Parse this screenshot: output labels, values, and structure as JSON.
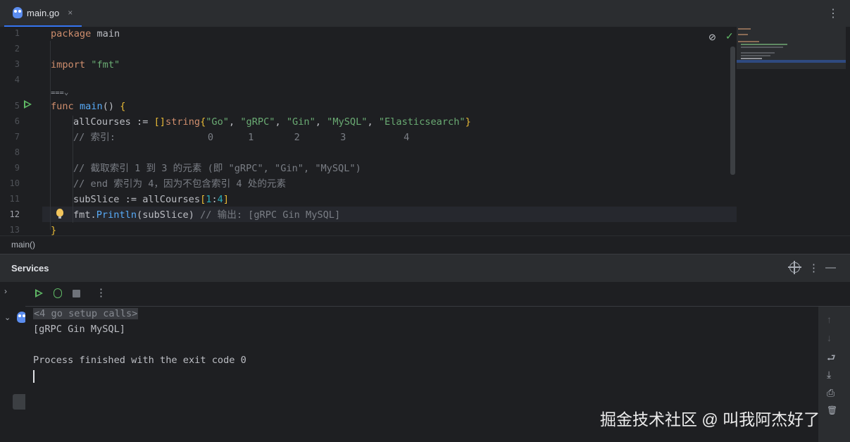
{
  "tab": {
    "file_name": "main.go",
    "close_glyph": "×",
    "menu_glyph": "⋮"
  },
  "editor": {
    "line_numbers": [
      "1",
      "2",
      "3",
      "4",
      "5",
      "6",
      "7",
      "8",
      "9",
      "10",
      "11",
      "12",
      "13"
    ],
    "lines": {
      "l1_kw": "package",
      "l1_rest": " main",
      "l3_kw": "import",
      "l3_str": "\"fmt\"",
      "l5_kw": "func",
      "l5_fn": "main",
      "l5_rest": "() ",
      "l6_a": "allCourses := ",
      "l6_b": "[]",
      "l6_c": "string",
      "l6_d": "{",
      "l6_s1": "\"Go\"",
      "l6_s2": "\"gRPC\"",
      "l6_s3": "\"Gin\"",
      "l6_s4": "\"MySQL\"",
      "l6_s5": "\"Elasticsearch\"",
      "l6_e": "}",
      "l7": "// 索引:                0      1       2       3          4",
      "l9": "// 截取索引 1 到 3 的元素 (即 \"gRPC\", \"Gin\", \"MySQL\")",
      "l10": "// end 索引为 4，因为不包含索引 4 处的元素",
      "l11_a": "subSlice := allCourses",
      "l11_b": "[",
      "l11_n1": "1",
      "l11_c": ":",
      "l11_n2": "4",
      "l11_d": "]",
      "l12_a": "fmt.",
      "l12_fn": "Println",
      "l12_b": "(subSlice) ",
      "l12_com": "// 输出: [gRPC Gin MySQL]",
      "l13": "}"
    },
    "inlay_hint": "⩶⌄",
    "breadcrumb": "main()"
  },
  "services": {
    "title": "Services",
    "more_glyph": "⋮",
    "minimize_glyph": "—",
    "tree_expand_glyph": "›",
    "tree_node_glyph": "⌄",
    "console": {
      "setup_calls": "<4 go setup calls>",
      "output": "[gRPC Gin MySQL]",
      "exit": "Process finished with the exit code 0"
    },
    "right_tools": {
      "up": "↑",
      "down": "↓",
      "wrap": "⮐",
      "scroll_end": "⤓",
      "print": "⎙",
      "clear": "🗑"
    }
  },
  "watermark": "掘金技术社区 @ 叫我阿杰好了",
  "colors": {
    "accent": "#3574f0",
    "run": "#5fb865",
    "keyword": "#cf8e6d",
    "string": "#6aab73",
    "function": "#57aaf7",
    "number": "#2aacb8",
    "comment": "#7a7e85"
  }
}
